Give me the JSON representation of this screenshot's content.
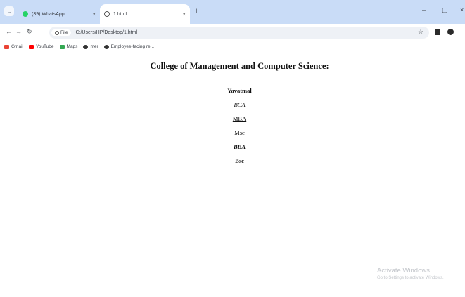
{
  "tabs": [
    {
      "label": "(39) WhatsApp",
      "active": false
    },
    {
      "label": "1.html",
      "active": true
    }
  ],
  "window": {
    "minimize": "–",
    "maximize": "▢",
    "close": "×"
  },
  "address": {
    "chip_label": "File",
    "url": "C:/Users/HP/Desktop/1.html"
  },
  "bookmarks": [
    {
      "label": "Gmail",
      "color": "#ea4335"
    },
    {
      "label": "YouTube",
      "color": "#ff0000"
    },
    {
      "label": "Maps",
      "color": "#34a853"
    },
    {
      "label": "mer",
      "color": "#333333"
    },
    {
      "label": "Employee-facing re...",
      "color": "#333333"
    }
  ],
  "page": {
    "heading": "College of Management and Computer Science:",
    "items": [
      {
        "text": "Yavatmal",
        "style": "bold"
      },
      {
        "text": "BCA",
        "style": "ital"
      },
      {
        "text": "MBA",
        "style": "ul"
      },
      {
        "text": "Msc",
        "style": "ul"
      },
      {
        "text": "BBA",
        "style": "bold ital"
      },
      {
        "text": "Bsc",
        "style": "bold ul"
      }
    ]
  },
  "watermark": {
    "line1": "Activate Windows",
    "line2": "Go to Settings to activate Windows."
  },
  "colors": {
    "tabstrip": "#c9dcf7",
    "accent": "#1a73e8"
  }
}
